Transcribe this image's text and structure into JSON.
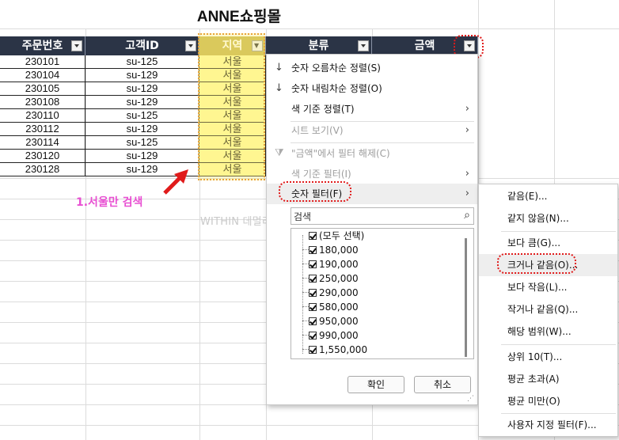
{
  "title": "ANNE쇼핑몰",
  "columns": [
    "주문번호",
    "고객ID",
    "지역",
    "분류",
    "금액"
  ],
  "rows": [
    [
      "230101",
      "su-125",
      "서울"
    ],
    [
      "230104",
      "su-129",
      "서울"
    ],
    [
      "230105",
      "su-129",
      "서울"
    ],
    [
      "230108",
      "su-129",
      "서울"
    ],
    [
      "230110",
      "su-125",
      "서울"
    ],
    [
      "230112",
      "su-129",
      "서울"
    ],
    [
      "230114",
      "su-125",
      "서울"
    ],
    [
      "230120",
      "su-129",
      "서울"
    ],
    [
      "230128",
      "su-129",
      "서울"
    ]
  ],
  "annotation": "1.서울만 검색",
  "watermark": "WITHIN 데멀리 엑셀이 날아오르자 ©anne",
  "menu": {
    "sort_asc": "숫자 오름차순 정렬(S)",
    "sort_desc": "숫자 내림차순 정렬(O)",
    "sort_by_color": "색 기준 정렬(T)",
    "sheet_view": "시트 보기(V)",
    "clear_filter": "\"금액\"에서 필터 해제(C)",
    "filter_by_color": "색 기준 필터(I)",
    "number_filter": "숫자 필터(F)",
    "search_placeholder": "검색",
    "list_items": [
      "(모두 선택)",
      "180,000",
      "190,000",
      "250,000",
      "290,000",
      "580,000",
      "950,000",
      "990,000",
      "1,550,000"
    ],
    "ok": "확인",
    "cancel": "취소"
  },
  "submenu": {
    "items": [
      "같음(E)...",
      "같지 않음(N)...",
      "보다 큼(G)...",
      "크거나 같음(O)...",
      "보다 작음(L)...",
      "작거나 같음(Q)...",
      "해당 범위(W)...",
      "상위 10(T)...",
      "평균 초과(A)",
      "평균 미만(O)",
      "사용자 지정 필터(F)..."
    ]
  },
  "colors": {
    "header_bg": "#2b3446",
    "region_header_bg": "#c7b64d",
    "region_cell_bg": "#fffa9e",
    "annotation": "#e84fd2",
    "highlight_red": "#e01b1b"
  }
}
